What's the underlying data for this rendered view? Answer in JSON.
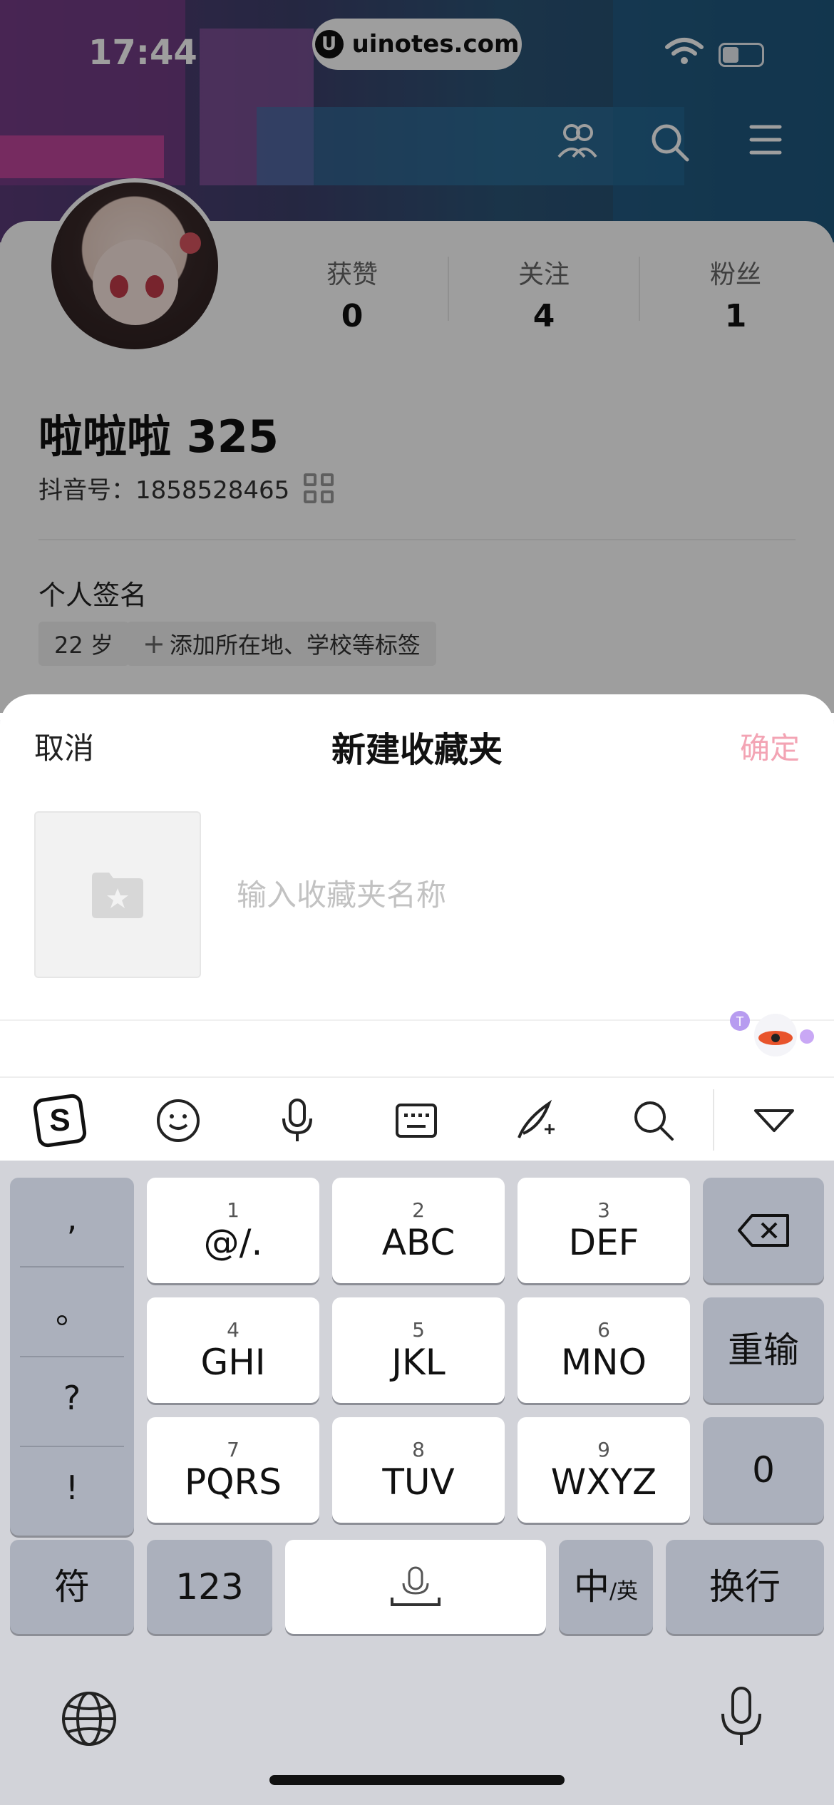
{
  "status_bar": {
    "time": "17:44",
    "url": "uinotes.com"
  },
  "header_icons": [
    "friends-icon",
    "search-icon",
    "menu-icon"
  ],
  "profile": {
    "stats": [
      {
        "label": "获赞",
        "value": "0"
      },
      {
        "label": "关注",
        "value": "4"
      },
      {
        "label": "粉丝",
        "value": "1"
      }
    ],
    "username": "啦啦啦 325",
    "douyin_id": "抖音号：1858528465",
    "signature": "个人签名",
    "tags": [
      "22 岁",
      "添加所在地、学校等标签"
    ]
  },
  "sheet": {
    "cancel": "取消",
    "title": "新建收藏夹",
    "confirm": "确定",
    "input_placeholder": "输入收藏夹名称"
  },
  "keyboard": {
    "punct": [
      ",",
      "。",
      "?",
      "!"
    ],
    "rows": [
      [
        {
          "sub": "1",
          "main": "@/."
        },
        {
          "sub": "2",
          "main": "ABC"
        },
        {
          "sub": "3",
          "main": "DEF"
        }
      ],
      [
        {
          "sub": "4",
          "main": "GHI"
        },
        {
          "sub": "5",
          "main": "JKL"
        },
        {
          "sub": "6",
          "main": "MNO"
        }
      ],
      [
        {
          "sub": "7",
          "main": "PQRS"
        },
        {
          "sub": "8",
          "main": "TUV"
        },
        {
          "sub": "9",
          "main": "WXYZ"
        }
      ]
    ],
    "right": {
      "reinput": "重输",
      "zero": "0"
    },
    "bottom": {
      "symbols": "符",
      "numbers": "123",
      "lang_main": "中",
      "lang_sub": "/英",
      "newline": "换行"
    }
  },
  "colors": {
    "accent_pink": "#f3a4b4",
    "key_gray": "#abb0bc",
    "keyboard_bg": "#d2d3d9"
  }
}
